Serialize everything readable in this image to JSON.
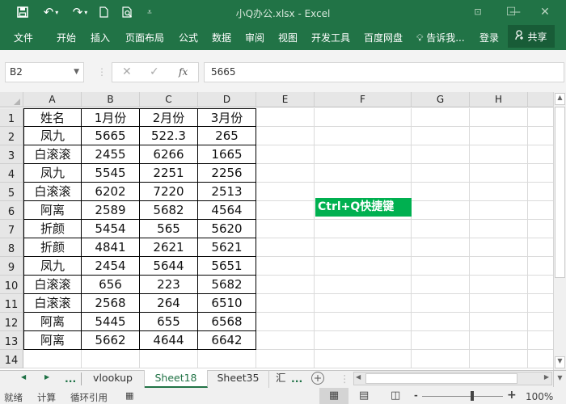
{
  "titlebar": {
    "title": "小Q办公.xlsx - Excel",
    "quick_access": [
      "save-icon",
      "undo-icon",
      "redo-icon",
      "new-file-icon",
      "print-preview-icon",
      "customize-icon"
    ],
    "window_buttons": [
      "ribbon-display-icon",
      "minimize-icon",
      "maximize-icon",
      "close-icon"
    ]
  },
  "ribbon": {
    "tabs": [
      "文件",
      "开始",
      "插入",
      "页面布局",
      "公式",
      "数据",
      "审阅",
      "视图",
      "开发工具",
      "百度网盘"
    ],
    "tell_me": "告诉我...",
    "login": "登录",
    "share": "共享"
  },
  "formula_bar": {
    "name_box": "B2",
    "fx": "fx",
    "value": "5665"
  },
  "columns": [
    "A",
    "B",
    "C",
    "D",
    "E",
    "F",
    "G",
    "H"
  ],
  "rows": [
    "1",
    "2",
    "3",
    "4",
    "5",
    "6",
    "7",
    "8",
    "9",
    "10",
    "11",
    "12",
    "13",
    "14"
  ],
  "table": {
    "headers": [
      "姓名",
      "1月份",
      "2月份",
      "3月份"
    ],
    "rows": [
      [
        "凤九",
        "5665",
        "522.3",
        "265"
      ],
      [
        "白滚滚",
        "2455",
        "6266",
        "1665"
      ],
      [
        "凤九",
        "5545",
        "2251",
        "2256"
      ],
      [
        "白滚滚",
        "6202",
        "7220",
        "2513"
      ],
      [
        "阿离",
        "2589",
        "5682",
        "4564"
      ],
      [
        "折颜",
        "5454",
        "565",
        "5620"
      ],
      [
        "折颜",
        "4841",
        "2621",
        "5621"
      ],
      [
        "凤九",
        "2454",
        "5644",
        "5651"
      ],
      [
        "白滚滚",
        "656",
        "223",
        "5682"
      ],
      [
        "白滚滚",
        "2568",
        "264",
        "6510"
      ],
      [
        "阿离",
        "5445",
        "655",
        "6568"
      ],
      [
        "阿离",
        "5662",
        "4644",
        "6642"
      ]
    ]
  },
  "label_cell": "Ctrl+Q快捷键",
  "sheet_tabs": {
    "more": "...",
    "tabs": [
      "vlookup",
      "Sheet18",
      "Sheet35",
      "汇"
    ],
    "active": "Sheet18"
  },
  "status": {
    "items": [
      "就绪",
      "计算",
      "循环引用"
    ],
    "zoom": "100%",
    "zoom_level_percent": 100
  },
  "colors": {
    "brand": "#217346",
    "label_fill": "#00b050",
    "active_tab_text": "#217346"
  }
}
